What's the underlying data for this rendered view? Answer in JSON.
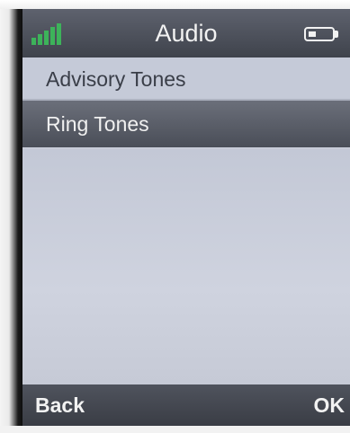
{
  "header": {
    "title": "Audio",
    "signal_icon": "signal-strength-icon",
    "battery_icon": "battery-icon",
    "signal_color": "#3db35a"
  },
  "menu": {
    "items": [
      {
        "label": "Advisory Tones",
        "selected": false
      },
      {
        "label": "Ring Tones",
        "selected": true
      }
    ]
  },
  "softkeys": {
    "left_label": "Back",
    "right_label": "OK"
  }
}
